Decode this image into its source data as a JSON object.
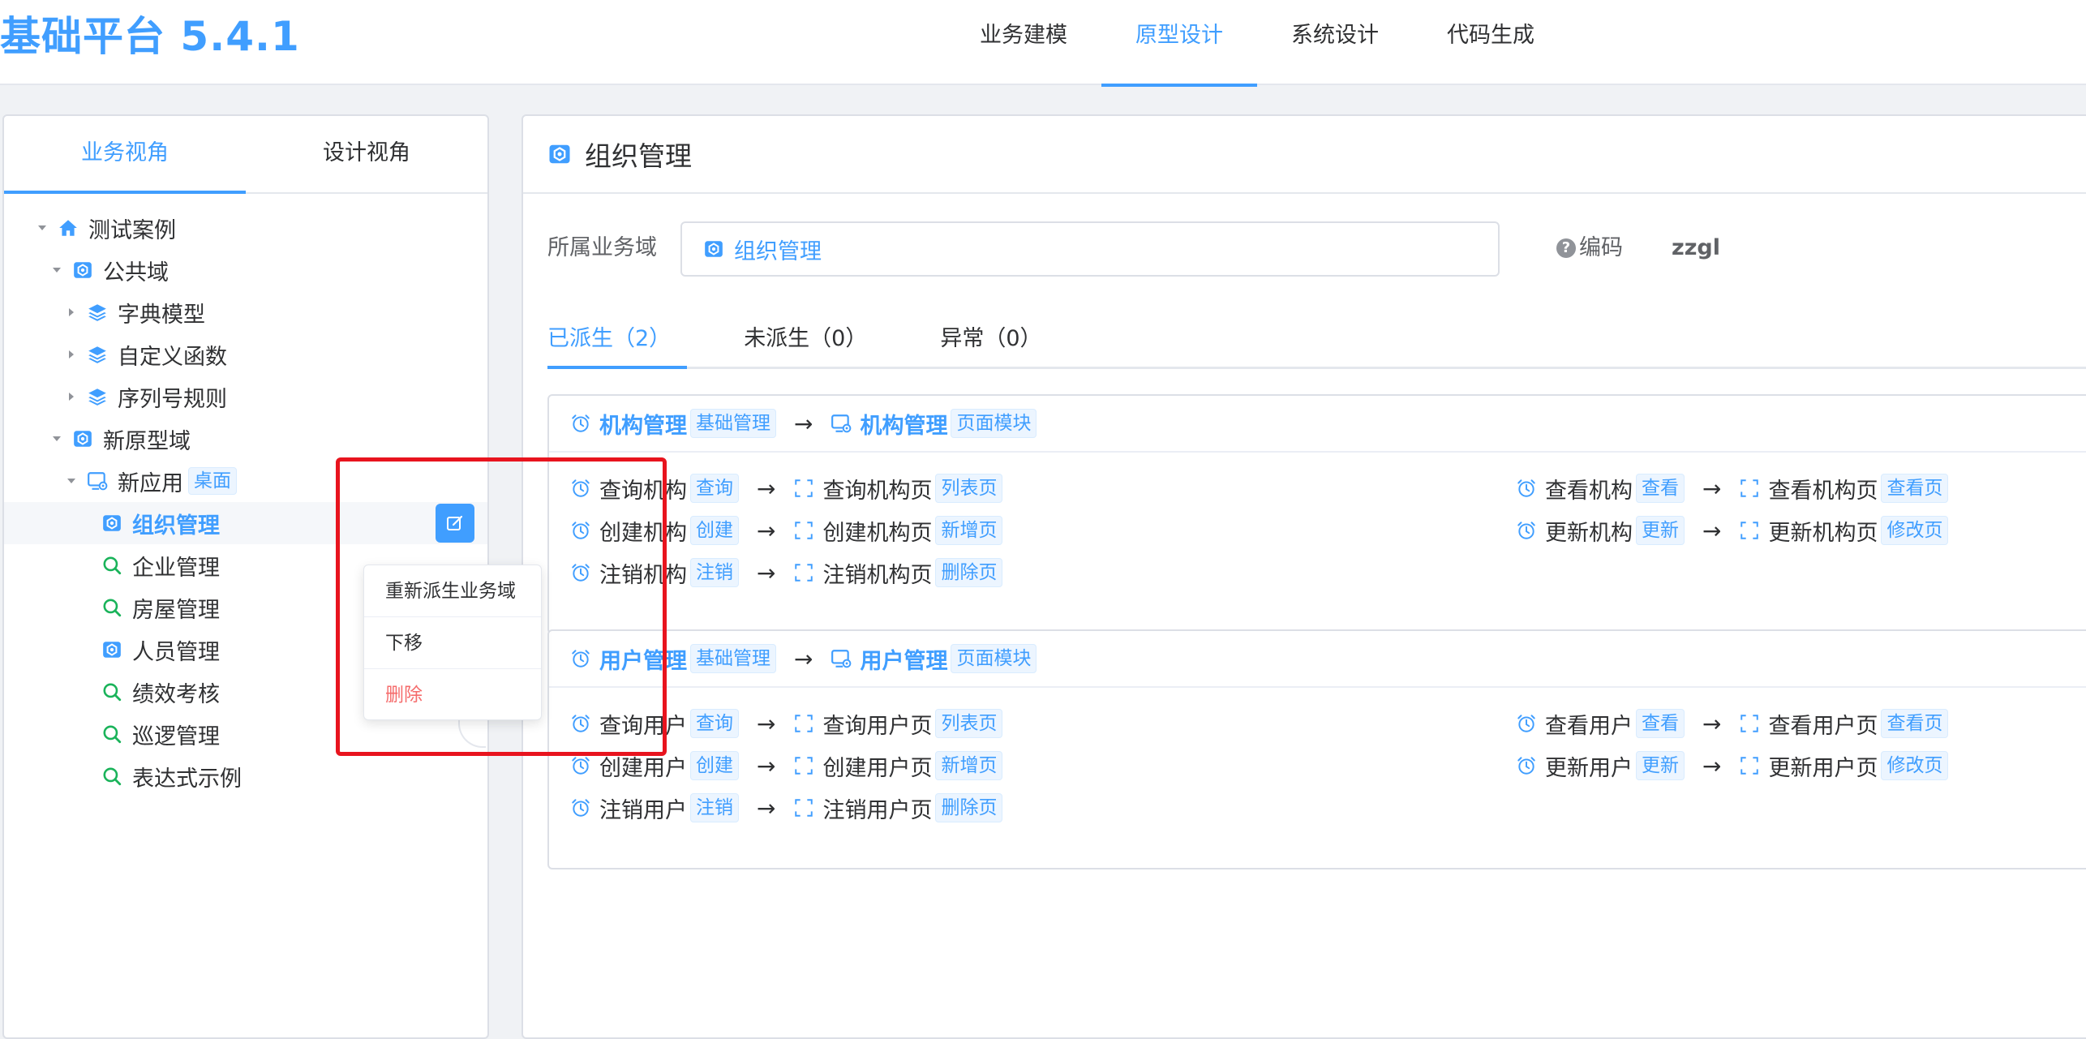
{
  "app": {
    "title": "基础平台 5.4.1"
  },
  "nav": {
    "items": [
      {
        "label": "业务建模",
        "active": false
      },
      {
        "label": "原型设计",
        "active": true
      },
      {
        "label": "系统设计",
        "active": false
      },
      {
        "label": "代码生成",
        "active": false
      }
    ]
  },
  "left": {
    "tabs": [
      {
        "label": "业务视角",
        "active": true
      },
      {
        "label": "设计视角",
        "active": false
      }
    ],
    "tree": [
      {
        "label": "测试案例",
        "level": 0,
        "caret": "down",
        "icon": "home-icon"
      },
      {
        "label": "公共域",
        "level": 1,
        "caret": "down",
        "icon": "domain-icon"
      },
      {
        "label": "字典模型",
        "level": 2,
        "caret": "right",
        "icon": "layers-icon"
      },
      {
        "label": "自定义函数",
        "level": 2,
        "caret": "right",
        "icon": "layers-icon"
      },
      {
        "label": "序列号规则",
        "level": 2,
        "caret": "right",
        "icon": "layers-icon"
      },
      {
        "label": "新原型域",
        "level": 1,
        "caret": "down",
        "icon": "domain-icon"
      },
      {
        "label": "新应用",
        "level": 2,
        "caret": "down",
        "icon": "desktop-app-icon",
        "tag": "桌面"
      },
      {
        "label": "组织管理",
        "level": 3,
        "caret": "none",
        "icon": "domain-icon",
        "selected": true
      },
      {
        "label": "企业管理",
        "level": 3,
        "caret": "none",
        "icon": "search-green-icon"
      },
      {
        "label": "房屋管理",
        "level": 3,
        "caret": "none",
        "icon": "search-green-icon"
      },
      {
        "label": "人员管理",
        "level": 3,
        "caret": "none",
        "icon": "domain-icon"
      },
      {
        "label": "绩效考核",
        "level": 3,
        "caret": "none",
        "icon": "search-green-icon"
      },
      {
        "label": "巡逻管理",
        "level": 3,
        "caret": "none",
        "icon": "search-green-icon"
      },
      {
        "label": "表达式示例",
        "level": 3,
        "caret": "none",
        "icon": "search-green-icon"
      }
    ],
    "context_menu": [
      {
        "label": "重新派生业务域",
        "danger": false
      },
      {
        "label": "下移",
        "danger": false
      },
      {
        "label": "删除",
        "danger": true
      }
    ]
  },
  "right": {
    "title": "组织管理",
    "domain_label": "所属业务域",
    "domain_value": "组织管理",
    "code_label": "编码",
    "code_value": "zzgl",
    "status_tabs": [
      {
        "label": "已派生（2）",
        "active": true
      },
      {
        "label": "未派生（0）",
        "active": false
      },
      {
        "label": "异常（0）",
        "active": false
      }
    ],
    "cards": [
      {
        "source": "机构管理",
        "source_tag": "基础管理",
        "target": "机构管理",
        "target_tag": "页面模块",
        "actions": [
          {
            "name": "查询机构",
            "tag": "查询",
            "page": "查询机构页",
            "page_tag": "列表页"
          },
          {
            "name": "查看机构",
            "tag": "查看",
            "page": "查看机构页",
            "page_tag": "查看页"
          },
          {
            "name": "创建机构",
            "tag": "创建",
            "page": "创建机构页",
            "page_tag": "新增页"
          },
          {
            "name": "更新机构",
            "tag": "更新",
            "page": "更新机构页",
            "page_tag": "修改页"
          },
          {
            "name": "注销机构",
            "tag": "注销",
            "page": "注销机构页",
            "page_tag": "删除页"
          }
        ]
      },
      {
        "source": "用户管理",
        "source_tag": "基础管理",
        "target": "用户管理",
        "target_tag": "页面模块",
        "actions": [
          {
            "name": "查询用户",
            "tag": "查询",
            "page": "查询用户页",
            "page_tag": "列表页"
          },
          {
            "name": "查看用户",
            "tag": "查看",
            "page": "查看用户页",
            "page_tag": "查看页"
          },
          {
            "name": "创建用户",
            "tag": "创建",
            "page": "创建用户页",
            "page_tag": "新增页"
          },
          {
            "name": "更新用户",
            "tag": "更新",
            "page": "更新用户页",
            "page_tag": "修改页"
          },
          {
            "name": "注销用户",
            "tag": "注销",
            "page": "注销用户页",
            "page_tag": "删除页"
          }
        ]
      }
    ]
  },
  "colors": {
    "primary": "#409eff",
    "danger": "#f56c6c",
    "highlight": "#e8141e",
    "green": "#1ab35a"
  }
}
